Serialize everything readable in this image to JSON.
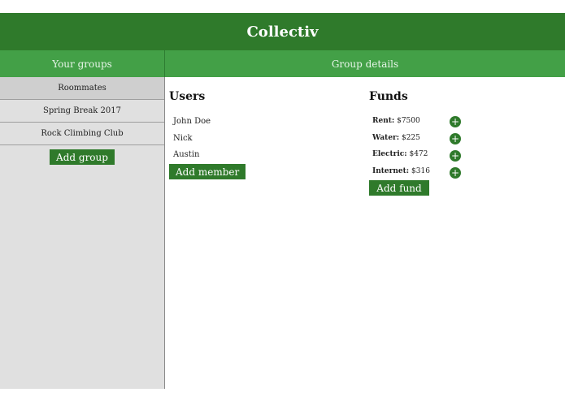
{
  "app": {
    "title": "Collectiv"
  },
  "subheader": {
    "left": "Your groups",
    "right": "Group details"
  },
  "groups": [
    {
      "label": "Roommates"
    },
    {
      "label": "Spring Break 2017"
    },
    {
      "label": "Rock Climbing Club"
    }
  ],
  "buttons": {
    "add_group": "Add group",
    "add_member": "Add member",
    "add_fund": "Add fund"
  },
  "users": {
    "title": "Users",
    "items": [
      "John Doe",
      "Nick",
      "Austin"
    ]
  },
  "funds": {
    "title": "Funds",
    "items": [
      {
        "name": "Rent:",
        "amount": "$7500"
      },
      {
        "name": "Water:",
        "amount": "$225"
      },
      {
        "name": "Electric:",
        "amount": "$472"
      },
      {
        "name": "Internet:",
        "amount": "$316"
      }
    ],
    "plus_symbol": "+"
  },
  "colors": {
    "header": "#2f7a2b",
    "subheader": "#43a047",
    "sidebar": "#e0e0e0"
  }
}
